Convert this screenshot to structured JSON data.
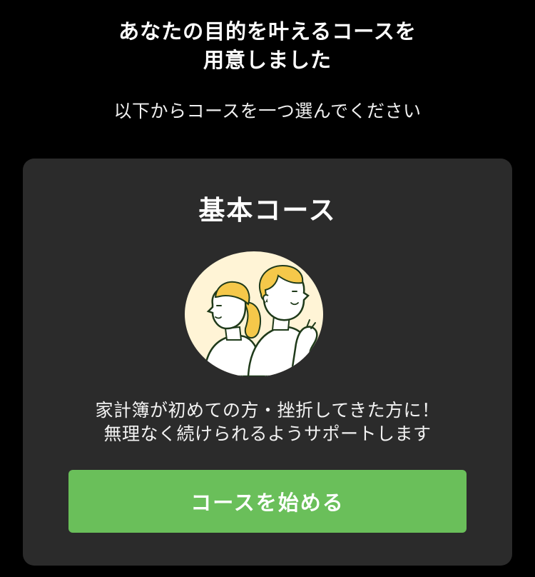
{
  "header": {
    "title_line1": "あなたの目的を叶えるコースを",
    "title_line2": "用意しました",
    "subtitle": "以下からコースを一つ選んでください"
  },
  "course_card": {
    "title": "基本コース",
    "illustration_icon": "two-people-illustration",
    "description_line1": "家計簿が初めての方・挫折してきた方に！",
    "description_line2": "無理なく続けられるようサポートします",
    "button_label": "コースを始める"
  },
  "colors": {
    "background": "#000000",
    "card": "#2b2b2b",
    "accent_green": "#6abf5a",
    "illustration_circle": "#fff4d6",
    "hair_yellow": "#f5c84a",
    "outline_green": "#1f3a1a"
  }
}
